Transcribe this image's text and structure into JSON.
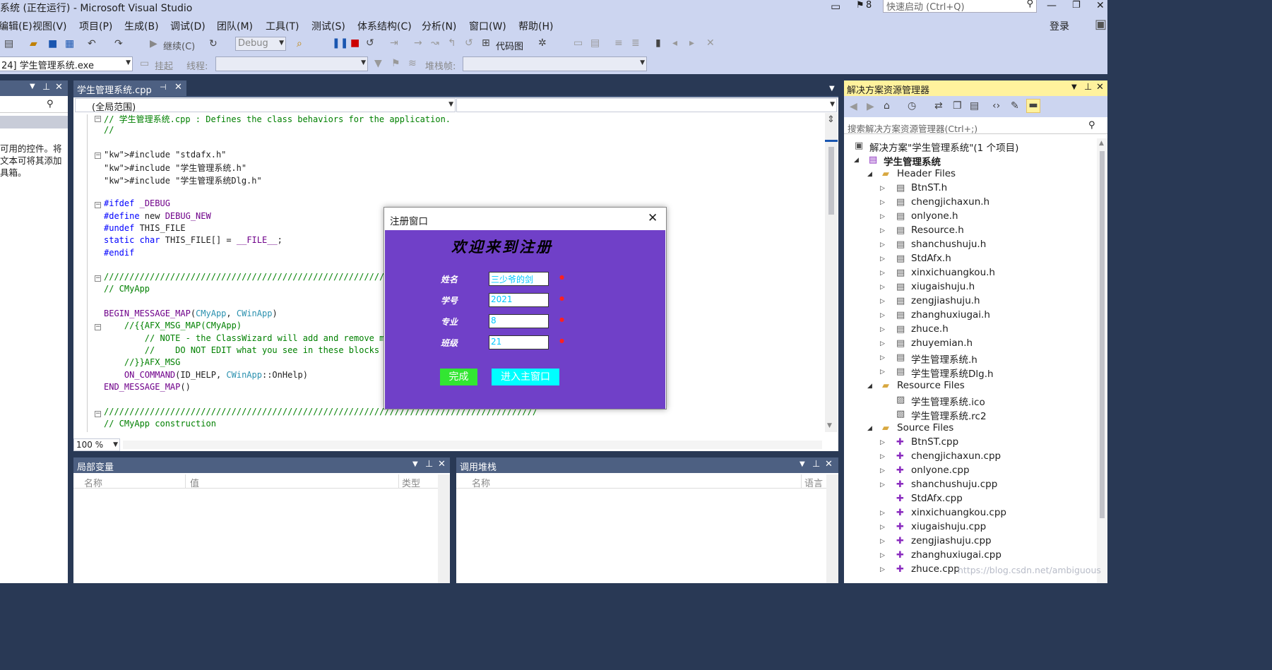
{
  "window": {
    "title": "系统 (正在运行) - Microsoft Visual Studio",
    "notif_count": "8",
    "quicklaunch_placeholder": "快速启动 (Ctrl+Q)",
    "login": "登录"
  },
  "menu": [
    "编辑(E)",
    "视图(V)",
    "项目(P)",
    "生成(B)",
    "调试(D)",
    "团队(M)",
    "工具(T)",
    "测试(S)",
    "体系结构(C)",
    "分析(N)",
    "窗口(W)",
    "帮助(H)"
  ],
  "toolbar": {
    "continue": "继续(C)",
    "config": "Debug",
    "codemap": "代码图",
    "process": "24] 学生管理系统.exe",
    "suspend": "挂起",
    "thread": "线程:",
    "stackframe": "堆栈帧:"
  },
  "left_panel": {
    "text": [
      "可用的控件。将",
      "文本可将其添加",
      "具箱。"
    ]
  },
  "editor": {
    "tab": "学生管理系统.cpp",
    "scope": "(全局范围)",
    "zoom": "100 %",
    "lines": [
      {
        "text": "// 学生管理系统.cpp : Defines the class behaviors for the application.",
        "cls": "cm"
      },
      {
        "text": "//",
        "cls": "cm"
      },
      {
        "text": "",
        "cls": ""
      },
      {
        "text": "#include \"stdafx.h\"",
        "cls": "inc"
      },
      {
        "text": "#include \"学生管理系统.h\"",
        "cls": "inc"
      },
      {
        "text": "#include \"学生管理系统Dlg.h\"",
        "cls": "inc"
      },
      {
        "text": "",
        "cls": ""
      },
      {
        "text": "#ifdef _DEBUG",
        "cls": "pp"
      },
      {
        "text": "#define new DEBUG_NEW",
        "cls": "pp"
      },
      {
        "text": "#undef THIS_FILE",
        "cls": "pp"
      },
      {
        "text": "static char THIS_FILE[] = __FILE__;",
        "cls": "pp"
      },
      {
        "text": "#endif",
        "cls": "pp"
      },
      {
        "text": "",
        "cls": ""
      },
      {
        "text": "/////////////////////////////////////////////////////////////////////////////////////",
        "cls": "cm"
      },
      {
        "text": "// CMyApp",
        "cls": "cm"
      },
      {
        "text": "",
        "cls": ""
      },
      {
        "text": "BEGIN_MESSAGE_MAP(CMyApp, CWinApp)",
        "cls": "mac"
      },
      {
        "text": "    //{{AFX_MSG_MAP(CMyApp)",
        "cls": "cm"
      },
      {
        "text": "        // NOTE - the ClassWizard will add and remove mapping macros here.",
        "cls": "cm"
      },
      {
        "text": "        //    DO NOT EDIT what you see in these blocks of generated code!",
        "cls": "cm"
      },
      {
        "text": "    //}}AFX_MSG",
        "cls": "cm"
      },
      {
        "text": "    ON_COMMAND(ID_HELP, CWinApp::OnHelp)",
        "cls": "mac"
      },
      {
        "text": "END_MESSAGE_MAP()",
        "cls": "mac"
      },
      {
        "text": "",
        "cls": ""
      },
      {
        "text": "/////////////////////////////////////////////////////////////////////////////////////",
        "cls": "cm"
      },
      {
        "text": "// CMyApp construction",
        "cls": "cm"
      }
    ]
  },
  "locals": {
    "title": "局部变量",
    "cols": [
      "名称",
      "值",
      "类型"
    ]
  },
  "callstack": {
    "title": "调用堆栈",
    "cols": [
      "名称",
      "语言"
    ]
  },
  "solution": {
    "title": "解决方案资源管理器",
    "search_placeholder": "搜索解决方案资源管理器(Ctrl+;)",
    "root": "解决方案\"学生管理系统\"(1 个项目)",
    "project": "学生管理系统",
    "header_folder": "Header Files",
    "headers": [
      "BtnST.h",
      "chengjichaxun.h",
      "onlyone.h",
      "Resource.h",
      "shanchushuju.h",
      "StdAfx.h",
      "xinxichuangkou.h",
      "xiugaishuju.h",
      "zengjiashuju.h",
      "zhanghuxiugai.h",
      "zhuce.h",
      "zhuyemian.h",
      "学生管理系统.h",
      "学生管理系统Dlg.h"
    ],
    "resource_folder": "Resource Files",
    "resources": [
      "学生管理系统.ico",
      "学生管理系统.rc2"
    ],
    "source_folder": "Source Files",
    "sources": [
      "BtnST.cpp",
      "chengjichaxun.cpp",
      "onlyone.cpp",
      "shanchushuju.cpp",
      "StdAfx.cpp",
      "xinxichuangkou.cpp",
      "xiugaishuju.cpp",
      "zengjiashuju.cpp",
      "zhanghuxiugai.cpp",
      "zhuce.cpp"
    ],
    "watermark": "https://blog.csdn.net/ambiguous"
  },
  "dialog": {
    "title": "注册窗口",
    "heading": "欢迎来到注册",
    "fields": [
      {
        "label": "姓名",
        "value": "三少爷的剑"
      },
      {
        "label": "学号",
        "value": "2021"
      },
      {
        "label": "专业",
        "value": "8"
      },
      {
        "label": "班级",
        "value": "21"
      }
    ],
    "finish": "完成",
    "enter": "进入主窗口"
  },
  "colors": {
    "accent": "#7040c8",
    "finish_btn": "#32e632",
    "enter_btn": "#00ffff",
    "panel_head": "#4d6082",
    "vs_bg": "#293955"
  }
}
